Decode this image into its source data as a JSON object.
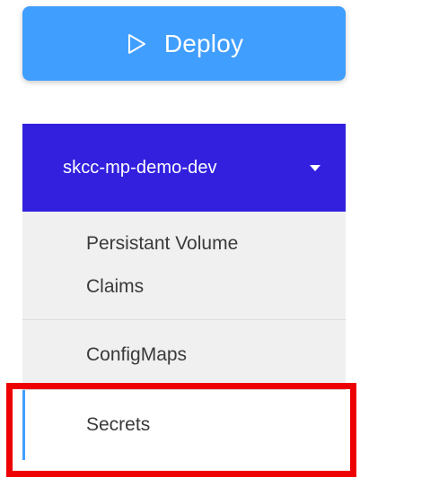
{
  "deploy": {
    "label": "Deploy",
    "icon": "play-outline-icon",
    "color": "#409eff"
  },
  "namespace": {
    "label": "skcc-mp-demo-dev",
    "icon": "caret-down-icon",
    "color": "#3220de"
  },
  "submenu": {
    "items": [
      {
        "label": "Persistant Volume Claims",
        "active": false
      },
      {
        "label": "ConfigMaps",
        "active": false
      },
      {
        "label": "Secrets",
        "active": true
      }
    ]
  },
  "highlight": {
    "color": "#ee0000",
    "target": "Secrets"
  }
}
